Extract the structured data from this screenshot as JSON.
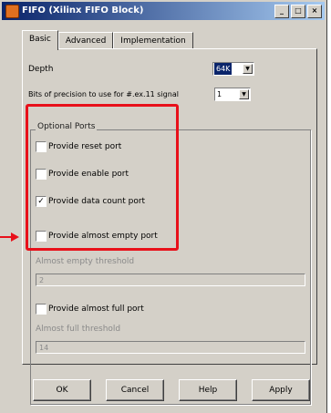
{
  "window": {
    "title": "FIFO (Xilinx FIFO Block)",
    "min_label": "_",
    "max_label": "□",
    "close_label": "×"
  },
  "tabs": [
    {
      "label": "Basic",
      "active": true
    },
    {
      "label": "Advanced",
      "active": false
    },
    {
      "label": "Implementation",
      "active": false
    }
  ],
  "depth": {
    "label": "Depth",
    "value": "64K"
  },
  "precision": {
    "label": "Bits of precision to use for #.ex.11 signal",
    "value": "1"
  },
  "optional_ports": {
    "title": "Optional Ports",
    "checkboxes": [
      {
        "label": "Provide reset port",
        "checked": false
      },
      {
        "label": "Provide enable port",
        "checked": false
      },
      {
        "label": "Provide data count port",
        "checked": true
      },
      {
        "label": "Provide almost empty port",
        "checked": false
      }
    ],
    "almost_empty_threshold": {
      "label": "Almost empty threshold",
      "value": "2"
    },
    "almost_full_port": {
      "label": "Provide almost full port",
      "checked": false
    },
    "almost_full_threshold": {
      "label": "Almost full threshold",
      "value": "14"
    }
  },
  "check_glyph": "✓",
  "highlight": {
    "color": "#e8101a"
  },
  "buttons": {
    "ok": "OK",
    "cancel": "Cancel",
    "help": "Help",
    "apply": "Apply"
  }
}
